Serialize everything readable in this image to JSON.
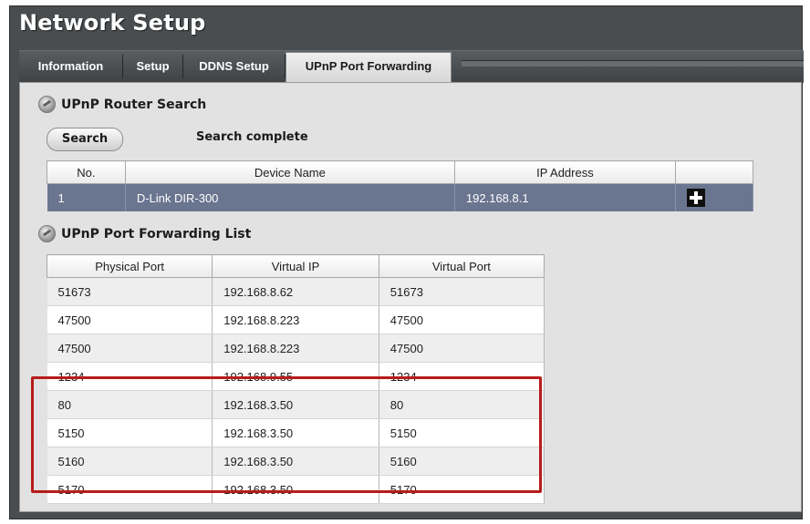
{
  "window": {
    "title": "Network Setup"
  },
  "tabs": [
    {
      "label": "Information"
    },
    {
      "label": "Setup"
    },
    {
      "label": "DDNS Setup"
    },
    {
      "label": "UPnP Port Forwarding",
      "active": true
    }
  ],
  "router_search": {
    "title": "UPnP Router Search",
    "search_button": "Search",
    "status": "Search complete",
    "columns": [
      "No.",
      "Device Name",
      "IP Address"
    ],
    "rows": [
      {
        "no": "1",
        "device_name": "D-Link DIR-300",
        "ip": "192.168.8.1"
      }
    ],
    "add_icon": "plus-icon"
  },
  "port_forwarding": {
    "title": "UPnP Port Forwarding List",
    "columns": [
      "Physical Port",
      "Virtual IP",
      "Virtual Port"
    ],
    "rows": [
      {
        "physical_port": "51673",
        "virtual_ip": "192.168.8.62",
        "virtual_port": "51673"
      },
      {
        "physical_port": "47500",
        "virtual_ip": "192.168.8.223",
        "virtual_port": "47500"
      },
      {
        "physical_port": "47500",
        "virtual_ip": "192.168.8.223",
        "virtual_port": "47500"
      },
      {
        "physical_port": "1234",
        "virtual_ip": "192.168.9.55",
        "virtual_port": "1234"
      },
      {
        "physical_port": "80",
        "virtual_ip": "192.168.3.50",
        "virtual_port": "80"
      },
      {
        "physical_port": "5150",
        "virtual_ip": "192.168.3.50",
        "virtual_port": "5150"
      },
      {
        "physical_port": "5160",
        "virtual_ip": "192.168.3.50",
        "virtual_port": "5160"
      },
      {
        "physical_port": "5170",
        "virtual_ip": "192.168.3.50",
        "virtual_port": "5170"
      }
    ]
  },
  "colors": {
    "frame": "#4a4d4f",
    "selected_row": "#6a7590",
    "highlight": "#b71c1c"
  }
}
